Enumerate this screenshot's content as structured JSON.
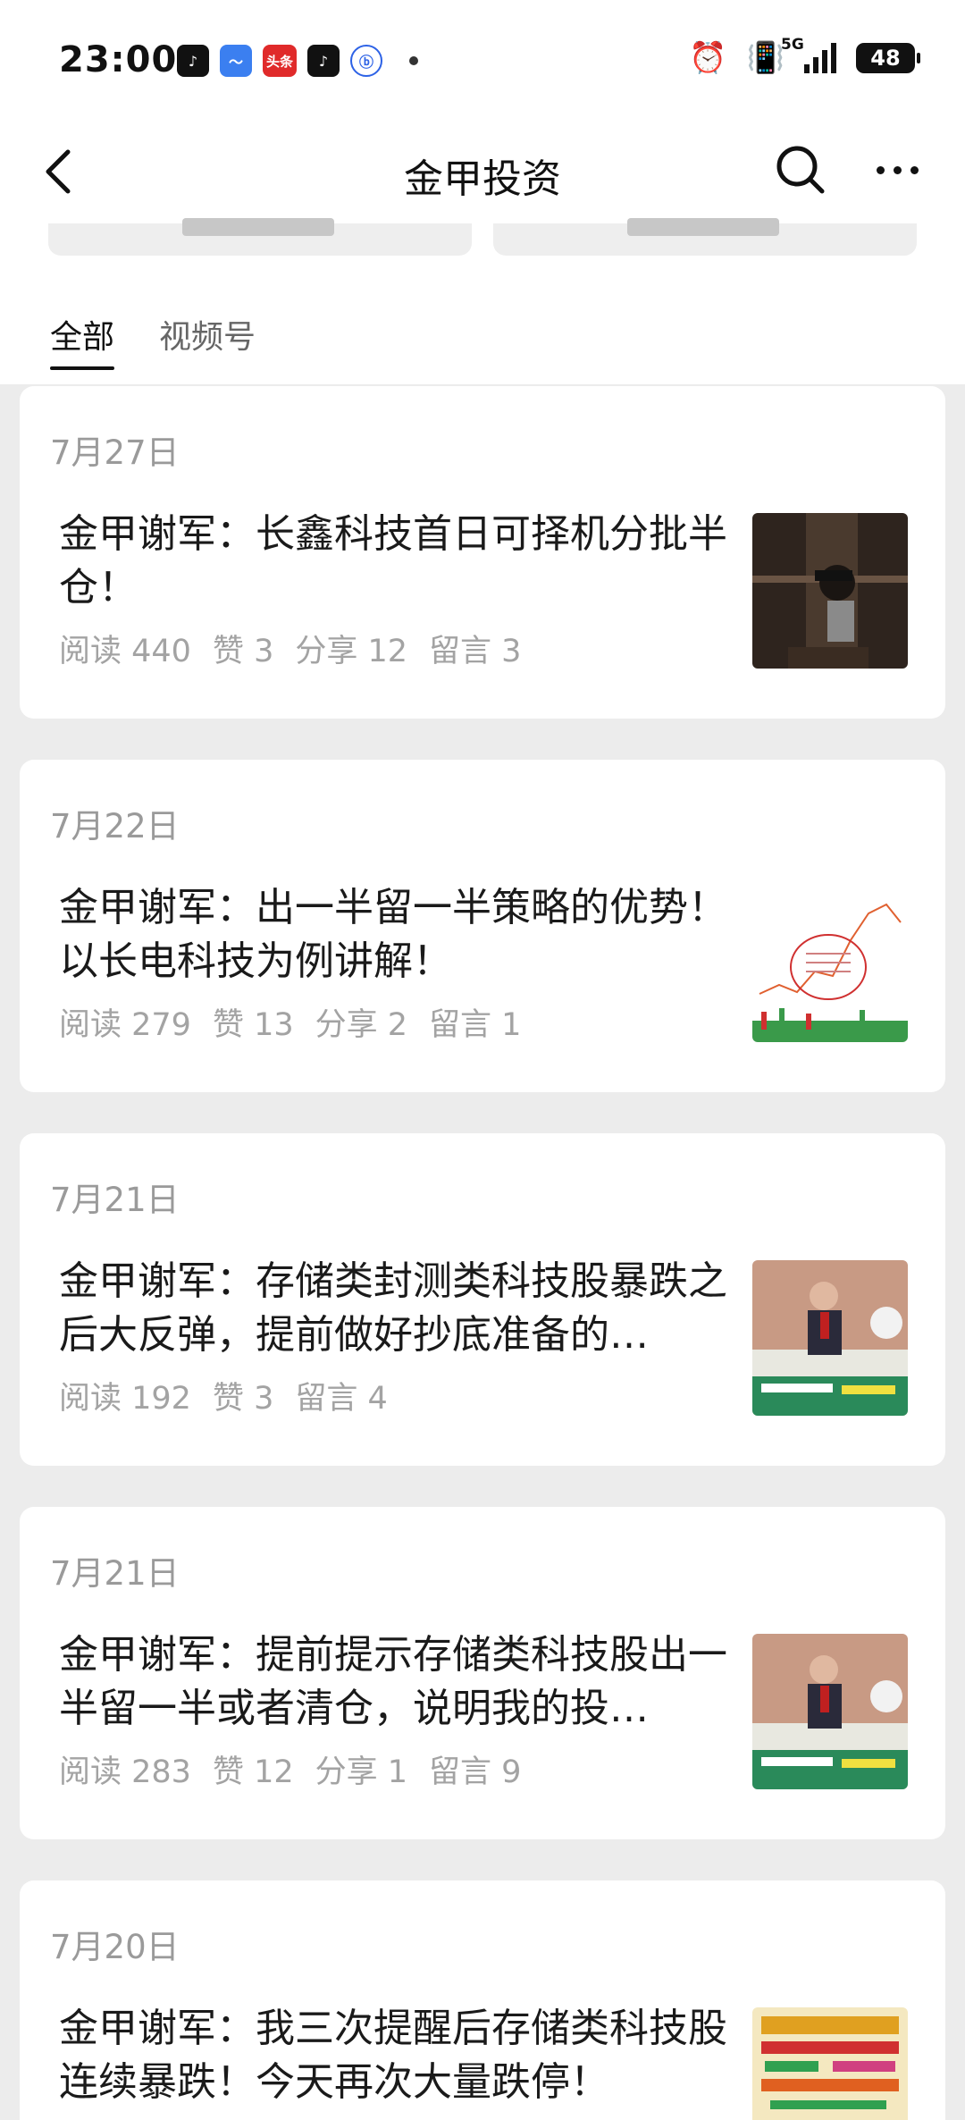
{
  "status_bar": {
    "time": "23:00",
    "app_icons": [
      "douyin-icon",
      "blue-app-icon",
      "toutiao-icon",
      "douyin-icon",
      "baidu-icon"
    ],
    "toutiao_label": "头条",
    "network_label": "5G",
    "battery_level": "48",
    "status_icons": [
      "alarm-icon",
      "vibrate-icon",
      "signal-icon",
      "battery-icon"
    ]
  },
  "nav": {
    "title": "金甲投资",
    "icons": [
      "back-chevron-icon",
      "search-icon",
      "more-icon"
    ]
  },
  "tabs": [
    {
      "label": "全部",
      "active": true
    },
    {
      "label": "视频号",
      "active": false
    }
  ],
  "articles": [
    {
      "date": "7月27日",
      "title": "金甲谢军：长鑫科技首日可择机分批半仓！",
      "stats": [
        "阅读 440",
        "赞 3",
        "分享 12",
        "留言 3"
      ],
      "thumb": "dark-room-photo"
    },
    {
      "date": "7月22日",
      "title": "金甲谢军：出一半留一半策略的优势！以长电科技为例讲解！",
      "stats": [
        "阅读 279",
        "赞 13",
        "分享 2",
        "留言 1"
      ],
      "thumb": "stock-chart-image"
    },
    {
      "date": "7月21日",
      "title": "金甲谢军：存储类封测类科技股暴跌之后大反弹，提前做好抄底准备的…",
      "stats": [
        "阅读 192",
        "赞 3",
        "留言 4"
      ],
      "thumb": "speaker-video-frame"
    },
    {
      "date": "7月21日",
      "title": "金甲谢军：提前提示存储类科技股出一半留一半或者清仓，说明我的投…",
      "stats": [
        "阅读 283",
        "赞 12",
        "分享 1",
        "留言 9"
      ],
      "thumb": "speaker-video-frame"
    },
    {
      "date": "7月20日",
      "title": "金甲谢军：我三次提醒后存储类科技股连续暴跌！今天再次大量跌停！",
      "stats": [],
      "thumb": "colorful-poster-image"
    }
  ]
}
